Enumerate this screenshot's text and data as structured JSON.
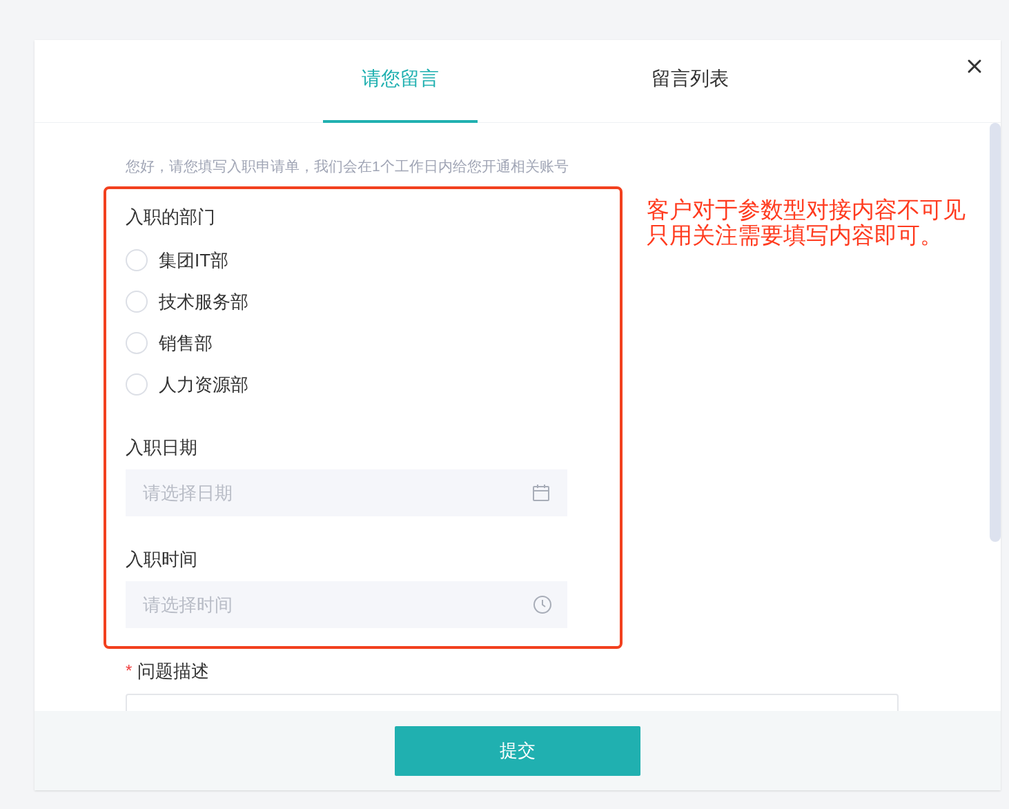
{
  "tabs": [
    {
      "label": "请您留言",
      "selected": true
    },
    {
      "label": "留言列表",
      "selected": false
    }
  ],
  "intro": "您好，请您填写入职申请单，我们会在1个工作日内给您开通相关账号",
  "department": {
    "label": "入职的部门",
    "options": [
      {
        "label": "集团IT部",
        "selected": false
      },
      {
        "label": "技术服务部",
        "selected": false
      },
      {
        "label": "销售部",
        "selected": false
      },
      {
        "label": "人力资源部",
        "selected": false
      }
    ]
  },
  "date_field": {
    "label": "入职日期",
    "placeholder": "请选择日期"
  },
  "time_field": {
    "label": "入职时间",
    "placeholder": "请选择时间"
  },
  "description": {
    "label": "问题描述",
    "required_mark": "*"
  },
  "annotation": [
    "客户对于参数型对接内容不可见",
    "只用关注需要填写内容即可。"
  ],
  "submit": "提交"
}
